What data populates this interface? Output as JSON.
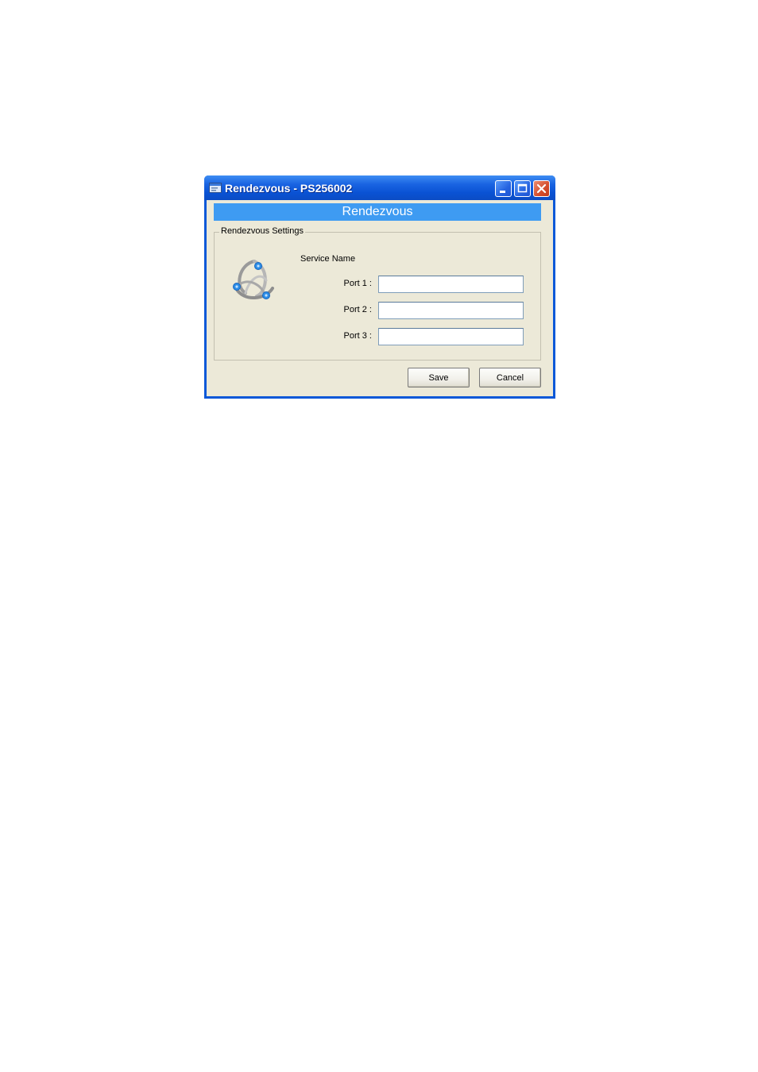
{
  "window": {
    "title": "Rendezvous - PS256002",
    "controls": [
      "minimize-icon",
      "maximize-icon",
      "close-icon"
    ]
  },
  "banner": {
    "text": "Rendezvous"
  },
  "group": {
    "label": "Rendezvous Settings",
    "service_name_label": "Service Name",
    "ports": [
      {
        "label": "Port 1 :",
        "value": ""
      },
      {
        "label": "Port 2 :",
        "value": ""
      },
      {
        "label": "Port 3 :",
        "value": ""
      }
    ]
  },
  "buttons": {
    "save": "Save",
    "cancel": "Cancel"
  },
  "colors": {
    "titlebar": "#0a52d4",
    "banner": "#3e9bf2",
    "client": "#ece9d8",
    "close": "#d44d2c"
  }
}
